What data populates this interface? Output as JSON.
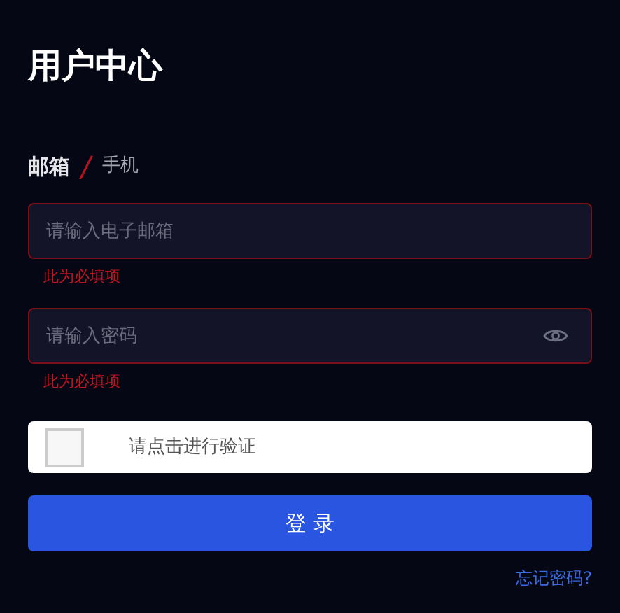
{
  "title": "用户中心",
  "tabs": [
    {
      "label": "邮箱",
      "selected": true
    },
    {
      "label": "手机",
      "selected": false
    }
  ],
  "separator": "/",
  "fields": [
    {
      "kind": "text",
      "placeholder": "请输入电子邮箱",
      "error": "此为必填项"
    },
    {
      "kind": "password",
      "placeholder": "请输入密码",
      "error": "此为必填项"
    }
  ],
  "captcha": {
    "label": "请点击进行验证",
    "checked": false
  },
  "submit": "登 录",
  "forgot_link": "忘记密码?"
}
